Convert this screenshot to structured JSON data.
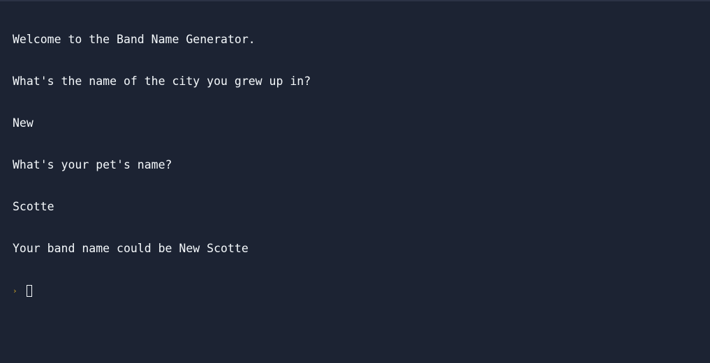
{
  "console": {
    "lines": [
      "Welcome to the Band Name Generator.",
      "What's the name of the city you grew up in?",
      "New",
      "What's your pet's name?",
      "Scotte",
      "Your band name could be New Scotte"
    ],
    "prompt_symbol": "›",
    "input_value": ""
  },
  "colors": {
    "background": "#1c2333",
    "text": "#f5f9fc",
    "prompt": "#c8a12a"
  }
}
